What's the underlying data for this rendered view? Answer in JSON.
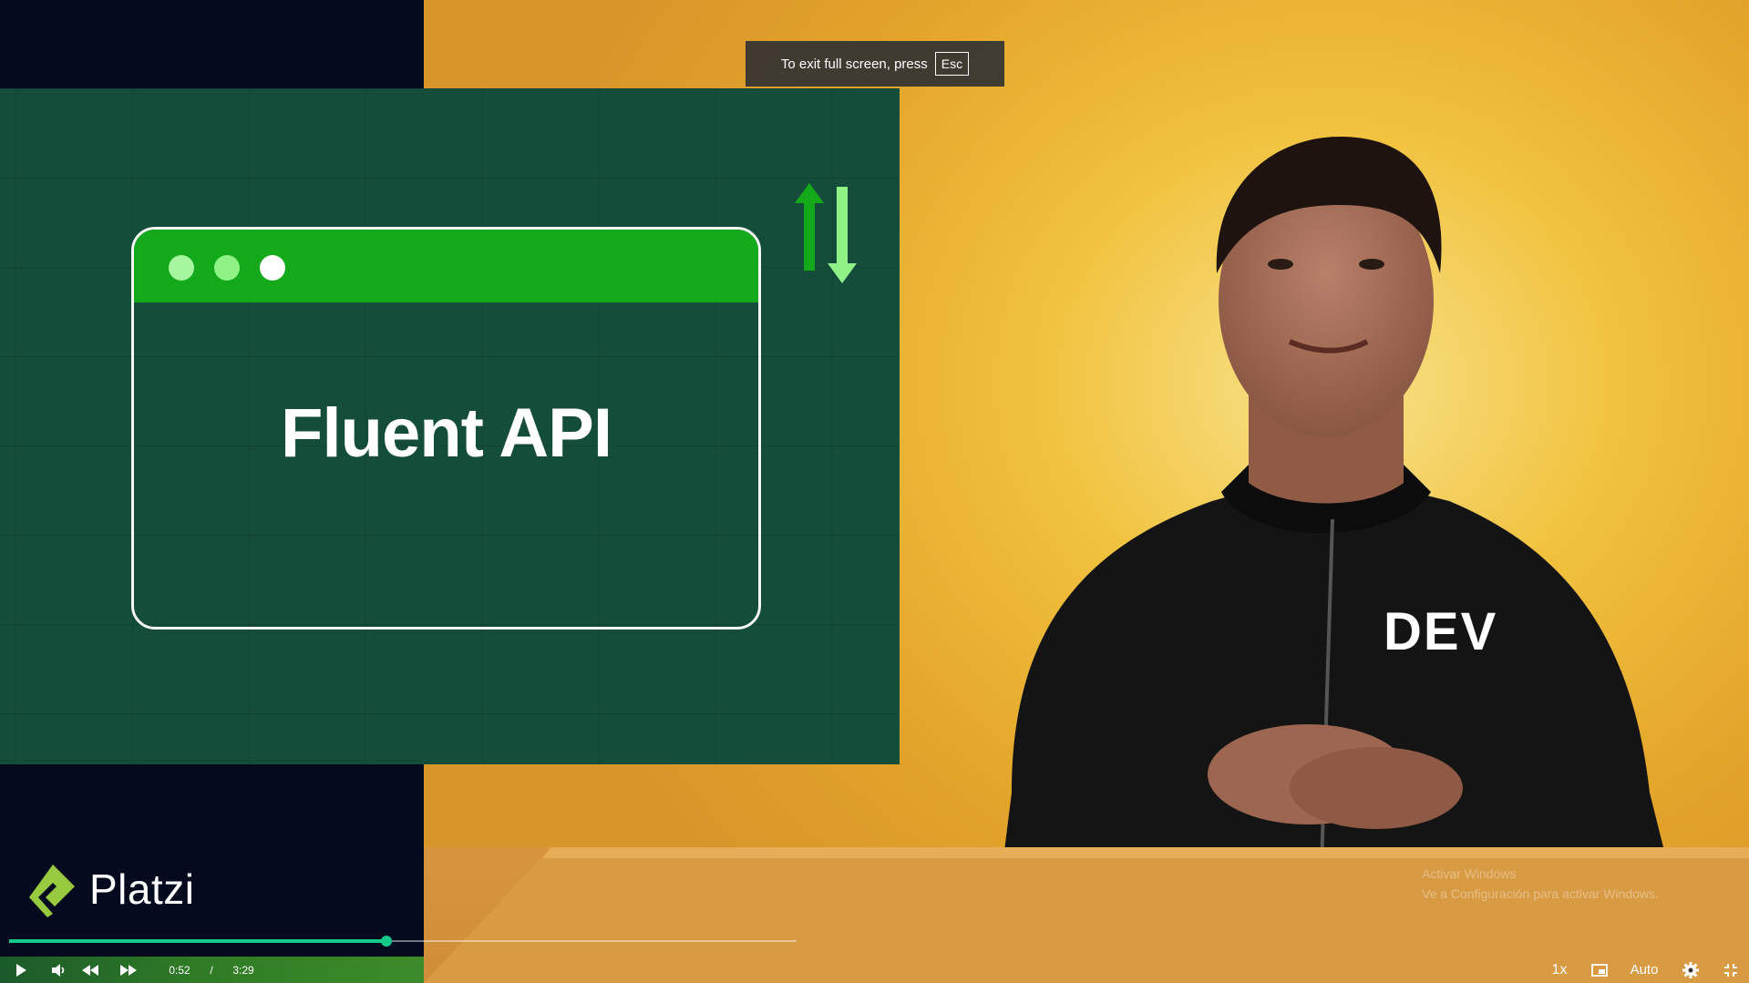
{
  "slide": {
    "title": "Fluent API"
  },
  "brand": {
    "name": "Platzi",
    "accent": "#98ca3f"
  },
  "toast": {
    "text": "To exit full screen, press",
    "key": "Esc"
  },
  "shirt_text": "DEV",
  "watermark": {
    "line1": "Activar Windows",
    "line2": "Ve a Configuración para activar Windows."
  },
  "player": {
    "current_time": "0:52",
    "separator": "/",
    "duration": "3:29",
    "progress_fraction": 0.4,
    "buffer_fraction": 0.835,
    "speed": "1x",
    "quality": "Auto",
    "progress_color": "#14c88a"
  },
  "icons": {
    "play": "play-icon",
    "volume": "volume-icon",
    "rewind": "rewind-icon",
    "forward": "forward-icon",
    "pip": "picture-in-picture-icon",
    "settings": "gear-icon",
    "exit_fullscreen": "exit-fullscreen-icon"
  }
}
